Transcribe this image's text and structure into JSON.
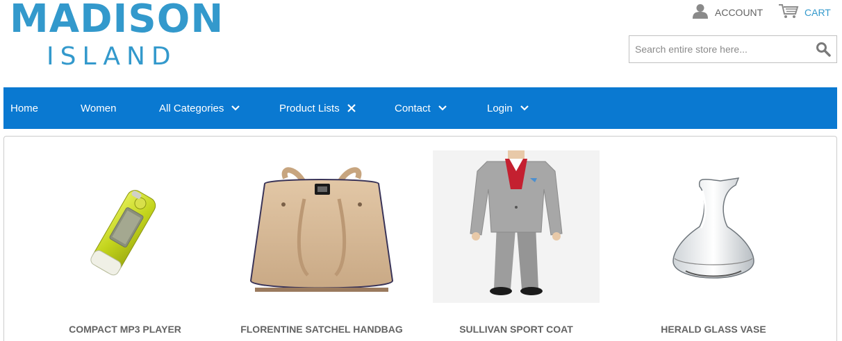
{
  "brand": {
    "line1": "MADISON",
    "line2": "ISLAND",
    "color": "#3399cc"
  },
  "header": {
    "account_label": "ACCOUNT",
    "account_icon": "user-icon",
    "cart_label": "CART",
    "cart_icon": "cart-icon",
    "search_placeholder": "Search entire store here...",
    "search_value": "",
    "search_icon": "search-icon"
  },
  "nav": {
    "background": "#0a79d1",
    "items": [
      {
        "label": "Home",
        "icon": ""
      },
      {
        "label": "Women",
        "icon": ""
      },
      {
        "label": "All Categories",
        "icon": "chevron-down-icon"
      },
      {
        "label": "Product Lists",
        "icon": "close-icon"
      },
      {
        "label": "Contact",
        "icon": "chevron-down-icon"
      },
      {
        "label": "Login",
        "icon": "chevron-down-icon"
      }
    ]
  },
  "products": [
    {
      "name": "COMPACT MP3 PLAYER",
      "image": "mp3-player-image"
    },
    {
      "name": "FLORENTINE SATCHEL HANDBAG",
      "image": "handbag-image"
    },
    {
      "name": "SULLIVAN SPORT COAT",
      "image": "sport-coat-image"
    },
    {
      "name": "HERALD GLASS VASE",
      "image": "glass-vase-image"
    }
  ]
}
